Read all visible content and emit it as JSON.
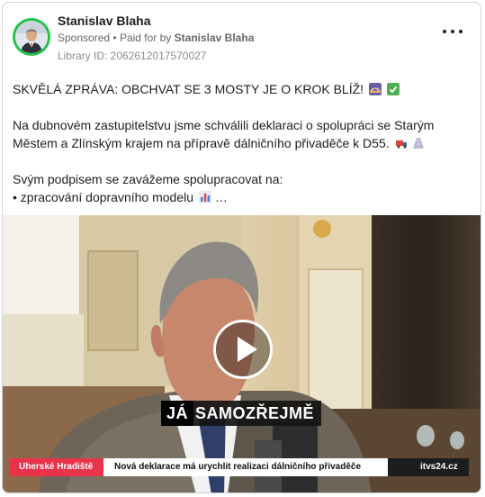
{
  "post": {
    "author_name": "Stanislav Blaha",
    "sponsored_label": "Sponsored",
    "paid_for_prefix": "Paid for by",
    "paid_for_name": "Stanislav Blaha",
    "library_id": "Library ID: 2062612017570027",
    "more_options_icon": "more-horizontal-icon",
    "text": {
      "line1": "SKVĚLÁ ZPRÁVA: OBCHVAT SE 3 MOSTY JE O KROK BLÍŽ!",
      "line2": "Na dubnovém zastupitelstvu jsme schválili deklaraci o spolupráci se Starým",
      "line3": "Městem a Zlínským krajem na přípravě dálničního přivaděče k D55.",
      "line4": "Svým podpisem se zavážeme spolupracovat na:",
      "line5": "• zpracování dopravního modelu",
      "ellipsis": "…"
    },
    "emoji_icons": [
      "bridge-emoji-icon",
      "check-mark-emoji-icon",
      "truck-emoji-icon",
      "road-emoji-icon",
      "bar-chart-emoji-icon"
    ]
  },
  "video": {
    "caption_ja": "JÁ",
    "caption_rest": "SAMOZŘEJMĚ",
    "ticker_location": "Uherské Hradiště",
    "ticker_headline": "Nová deklarace má urychlit realizaci dálničního přivaděče",
    "ticker_brand": "itvs24.cz",
    "play_icon": "play-icon"
  },
  "colors": {
    "avatar_ring": "#1fc24b",
    "ticker_red": "#e8334a",
    "muted_text": "#65676b"
  }
}
